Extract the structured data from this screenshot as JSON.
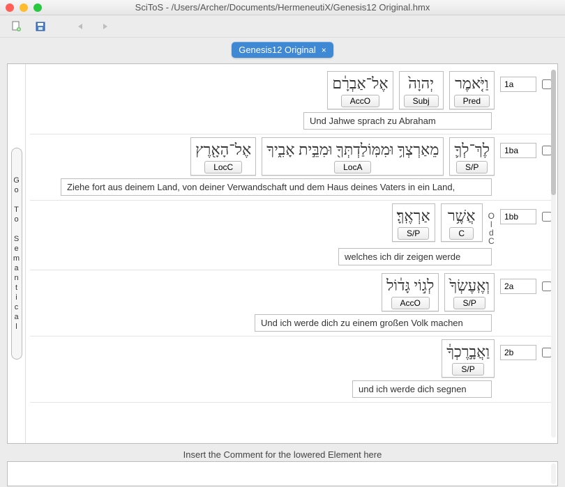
{
  "title": "SciToS - /Users/Archer/Documents/HermeneutiX/Genesis12 Original.hmx",
  "tab": {
    "label": "Genesis12 Original",
    "close": "×"
  },
  "sidebar": {
    "letters": [
      "G",
      "o",
      "",
      "T",
      "o",
      "",
      "S",
      "e",
      "m",
      "a",
      "n",
      "t",
      "i",
      "c",
      "a",
      "l"
    ]
  },
  "comment": {
    "label": "Insert the Comment for the lowered Element here"
  },
  "clauses": [
    {
      "ref": "1a",
      "units": [
        {
          "hebrew": "אֶל־אַבְרָ֔ם",
          "role": "AccO"
        },
        {
          "hebrew": "יְהוָה֙",
          "role": "Subj"
        },
        {
          "hebrew": "וַיֹּ֤אמֶר",
          "role": "Pred"
        }
      ],
      "translation": "Und Jahwe sprach zu Abraham",
      "trans_width": 270,
      "side": ""
    },
    {
      "ref": "1ba",
      "units": [
        {
          "hebrew": "אֶל־הָאָ֖רֶץ",
          "role": "LocC"
        },
        {
          "hebrew": "מֵאַרְצְךָ֥ וּמִמּֽוֹלַדְתְּךָ֖ וּמִבֵּ֣ית אָבִ֑יךָ",
          "role": "LocA"
        },
        {
          "hebrew": "לֶךְ־לְךָ֛",
          "role": "S/P"
        }
      ],
      "translation": "Ziehe fort aus deinem Land, von deiner Verwandschaft und dem Haus deines Vaters in ein Land,",
      "trans_width": 618,
      "side": ""
    },
    {
      "ref": "1bb",
      "units": [
        {
          "hebrew": "אַרְאֶֽךָּ׃",
          "role": "S/P"
        },
        {
          "hebrew": "אֲשֶׁ֥ר",
          "role": "C"
        }
      ],
      "translation": "welches ich dir zeigen werde",
      "trans_width": 220,
      "side": "OldC"
    },
    {
      "ref": "2a",
      "units": [
        {
          "hebrew": "לְג֣וֹי גָּד֔וֹל",
          "role": "AccO"
        },
        {
          "hebrew": "וְאֶֽעֶשְׂךָ֙",
          "role": "S/P"
        }
      ],
      "translation": "Und ich werde dich zu einem großen Volk machen",
      "trans_width": 340,
      "side": ""
    },
    {
      "ref": "2b",
      "units": [
        {
          "hebrew": "וַאֲבָ֣רֶכְךָ֔",
          "role": "S/P"
        }
      ],
      "translation": "und ich werde dich segnen",
      "trans_width": 200,
      "side": ""
    }
  ]
}
